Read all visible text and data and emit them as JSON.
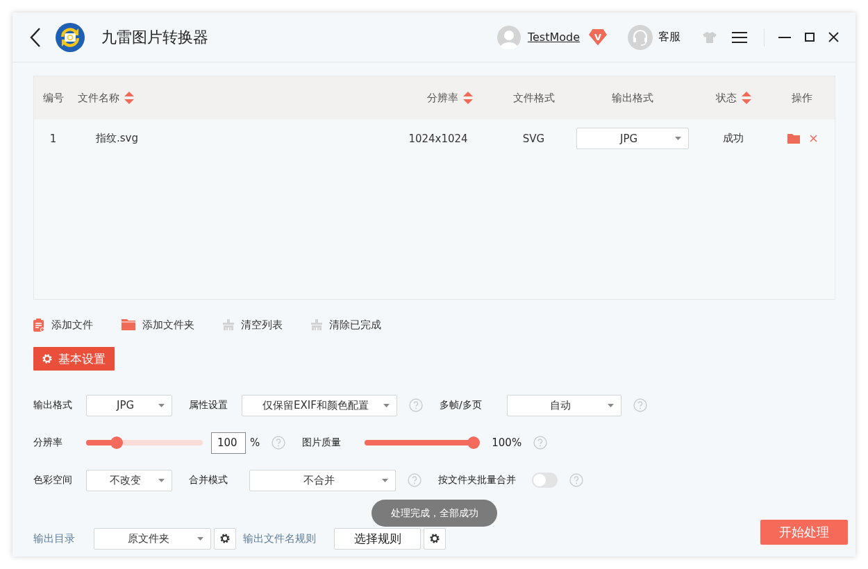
{
  "window": {
    "title": "九雷图片转换器"
  },
  "account": {
    "name": "TestMode",
    "badge": "V"
  },
  "support": {
    "label": "客服"
  },
  "table": {
    "columns": [
      {
        "label": "编号",
        "sortable": false
      },
      {
        "label": "文件名称",
        "sortable": true
      },
      {
        "label": "分辨率",
        "sortable": true
      },
      {
        "label": "文件格式",
        "sortable": false
      },
      {
        "label": "输出格式",
        "sortable": false
      },
      {
        "label": "状态",
        "sortable": true
      },
      {
        "label": "操作",
        "sortable": false
      }
    ],
    "rows": [
      {
        "index": "1",
        "name": "指纹.svg",
        "resolution": "1024x1024",
        "format": "SVG",
        "output_format": "JPG",
        "status": "成功"
      }
    ]
  },
  "actions": [
    {
      "kind": "add-file",
      "label": "添加文件",
      "disabled": false
    },
    {
      "kind": "add-folder",
      "label": "添加文件夹",
      "disabled": false
    },
    {
      "kind": "clear-list",
      "label": "清空列表",
      "disabled": true
    },
    {
      "kind": "clear-done",
      "label": "清除已完成",
      "disabled": true
    }
  ],
  "section_tab": {
    "label": "基本设置"
  },
  "settings": {
    "rows": [
      [
        {
          "kind": "select",
          "label": "输出格式",
          "value": "JPG",
          "help": false
        },
        {
          "kind": "select",
          "label": "属性设置",
          "value": "仅保留EXIF和颜色配置",
          "help": true
        },
        {
          "kind": "select",
          "label": "多帧/多页",
          "value": "自动",
          "help": true
        }
      ],
      [
        {
          "kind": "scale",
          "label": "分辨率",
          "level": 0.23,
          "value": "100",
          "unit": "%",
          "help": true
        },
        {
          "kind": "slider",
          "label": "图片质量",
          "level": 1,
          "reading": "100%",
          "help": true
        }
      ],
      [
        {
          "kind": "select",
          "label": "色彩空间",
          "value": "不改变",
          "help": false
        },
        {
          "kind": "select",
          "label": "合并模式",
          "value": "不合并",
          "help": true
        },
        {
          "kind": "toggle",
          "label": "按文件夹批量合并",
          "on": false,
          "help": true
        }
      ]
    ]
  },
  "output": {
    "dir_label": "输出目录",
    "dir_value": "原文件夹",
    "rule_label": "输出文件名规则",
    "rule_button": "选择规则"
  },
  "toast": {
    "message": "处理完成，全部成功"
  },
  "start_button": {
    "label": "开始处理"
  }
}
